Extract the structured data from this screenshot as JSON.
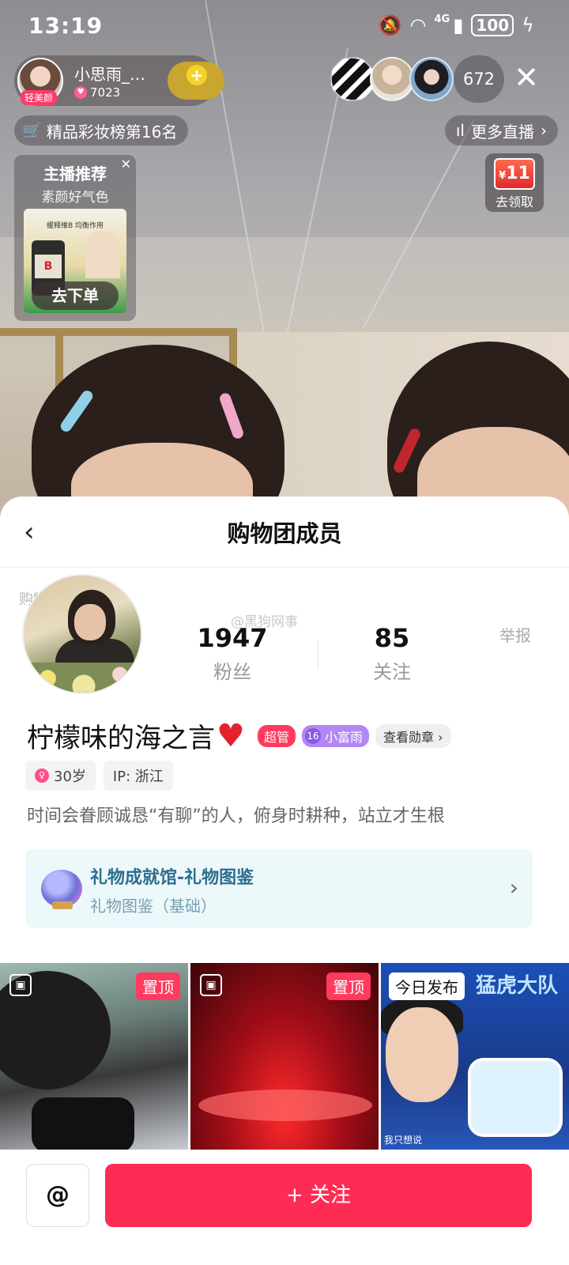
{
  "status_bar": {
    "time": "13:19",
    "network": "4G",
    "battery": "100"
  },
  "live": {
    "host": {
      "name": "小思雨_…",
      "badge": "轻美颜",
      "likes": "7023"
    },
    "viewer_count": "672",
    "rank_text": "精品彩妆榜第16名",
    "more_live": "更多直播",
    "product_card": {
      "title": "主播推荐",
      "subtitle": "素颜好气色",
      "image_tagline": "缓释维B 均衡作用",
      "image_letter": "B",
      "order_button": "去下单"
    },
    "coupon": {
      "currency": "¥",
      "amount": "11",
      "label": "去领取"
    }
  },
  "sheet": {
    "title": "购物团成员",
    "faint_text": "购物…万人",
    "watermark": "@黑狗网事",
    "stats": [
      {
        "value": "1947",
        "label": "粉丝"
      },
      {
        "value": "85",
        "label": "关注"
      }
    ],
    "report": "举报",
    "nickname": "柠檬味的海之言",
    "tags": {
      "admin": "超管",
      "fan_level": "16",
      "fan_club": "小富雨",
      "medal": "查看勋章 ›"
    },
    "age": "30岁",
    "ip": "IP: 浙江",
    "bio": "时间会眷顾诚恳“有聊”的人，俯身时耕种，站立才生根",
    "gift_card": {
      "title": "礼物成就馆-礼物图鉴",
      "subtitle": "礼物图鉴（基础）"
    },
    "thumbs": [
      {
        "tag": "置顶"
      },
      {
        "tag": "置顶"
      },
      {
        "tag": "今日发布",
        "art_title": "猛虎大队",
        "caption": "我只想说"
      }
    ],
    "at_button": "@",
    "follow_button": "+ 关注"
  }
}
